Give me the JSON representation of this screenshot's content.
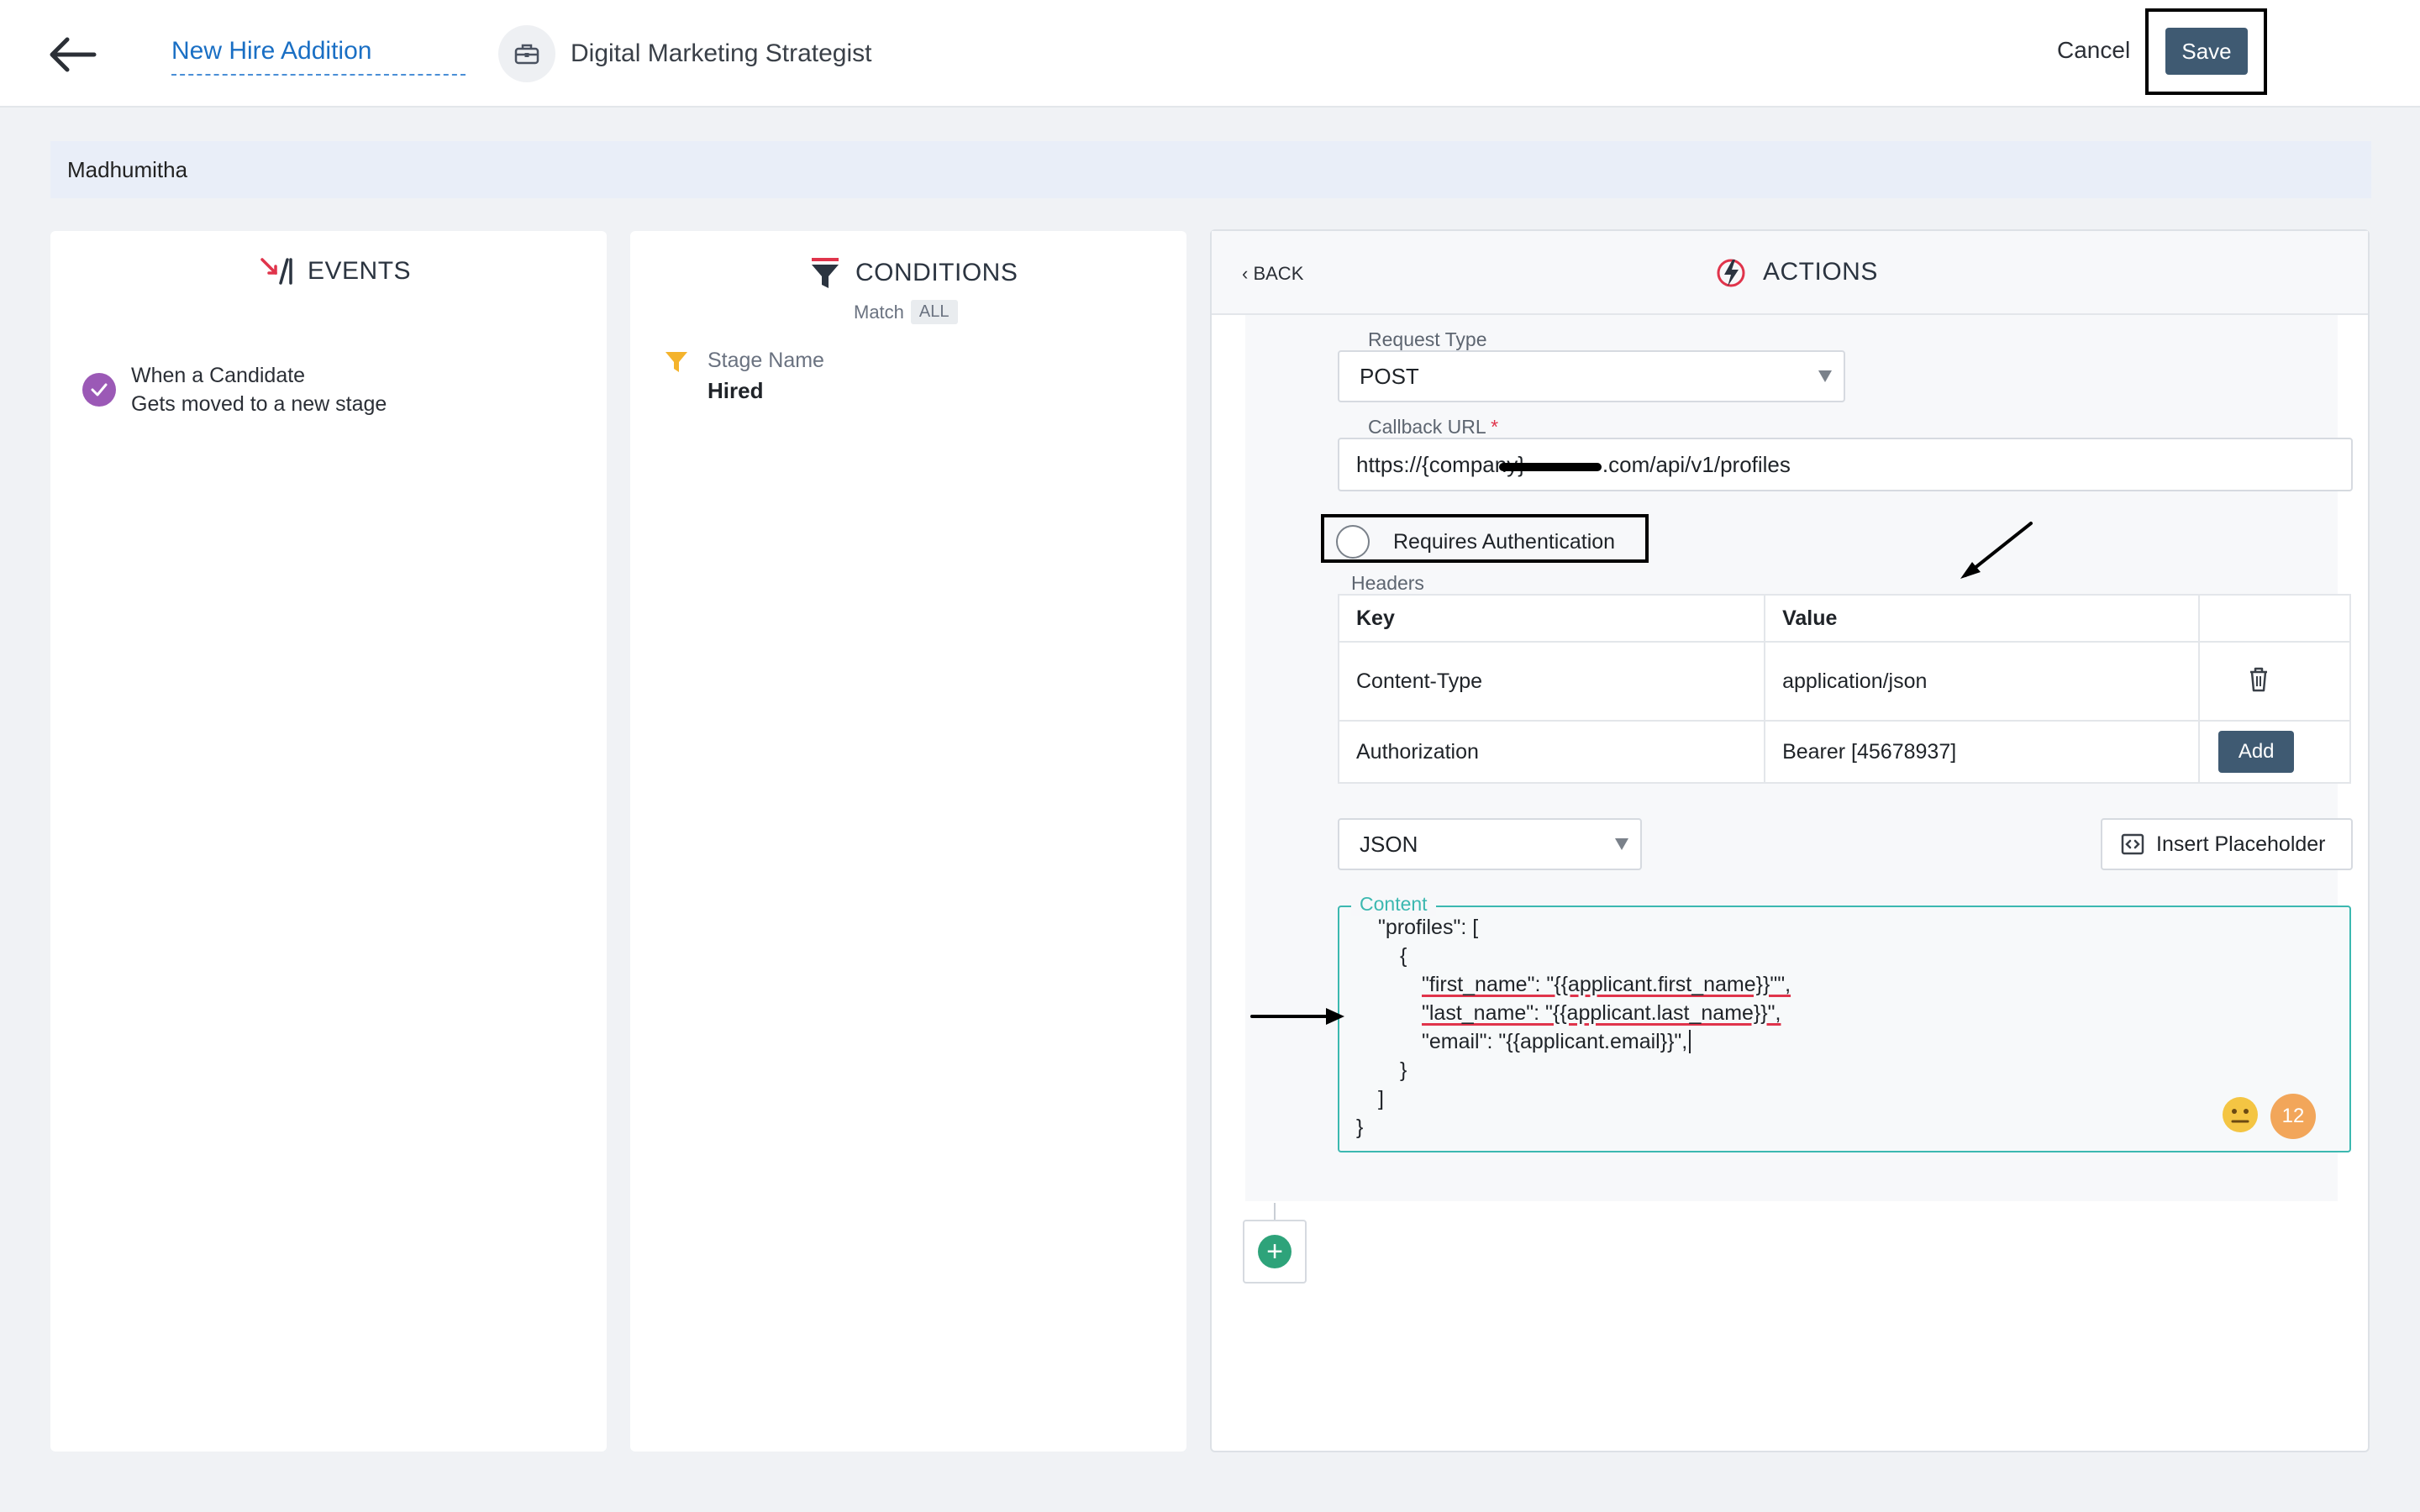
{
  "header": {
    "page_title": "New Hire Addition",
    "job_title": "Digital Marketing Strategist",
    "cancel_label": "Cancel",
    "save_label": "Save"
  },
  "candidate_name": "Madhumitha",
  "events": {
    "heading": "EVENTS",
    "items": [
      {
        "line1": "When a Candidate",
        "line2": "Gets moved to a new stage"
      }
    ]
  },
  "conditions": {
    "heading": "CONDITIONS",
    "match_label": "Match",
    "match_value": "ALL",
    "items": [
      {
        "label": "Stage Name",
        "value": "Hired"
      }
    ]
  },
  "actions": {
    "back_label": "BACK",
    "heading": "ACTIONS",
    "request_type_label": "Request Type",
    "request_type_value": "POST",
    "callback_url_label": "Callback URL",
    "required_marker": "*",
    "callback_url_prefix": "https://{company}",
    "callback_url_suffix": ".com/api/v1/profiles",
    "requires_auth_label": "Requires Authentication",
    "headers_label": "Headers",
    "headers_table": {
      "columns": [
        "Key",
        "Value"
      ],
      "rows": [
        {
          "key": "Content-Type",
          "value": "application/json"
        },
        {
          "key": "Authorization",
          "value": "Bearer [45678937]"
        }
      ],
      "add_label": "Add"
    },
    "format_value": "JSON",
    "insert_placeholder_label": "Insert Placeholder",
    "content_label": "Content",
    "content_lines": [
      "\"profiles\": [",
      "{",
      "\"first_name\": \"{{applicant.first_name}}\"\",",
      "\"last_name\": \"{{applicant.last_name}}\",",
      "\"email\": \"{{applicant.email}}\",",
      "}",
      "]",
      "}"
    ],
    "char_count": "12"
  },
  "colors": {
    "accent_blue": "#1a6fc4",
    "save_button": "#3f5a72",
    "check_purple": "#9b59b6",
    "content_border": "#3cb8b0",
    "badge_orange": "#f2a65a",
    "add_green": "#2ea37a"
  },
  "icons": {
    "back": "arrow-left-icon",
    "job": "briefcase-icon",
    "events": "events-logo-icon",
    "conditions": "filter-icon",
    "actions": "lightning-icon",
    "trash": "trash-icon",
    "insert": "code-bracket-icon",
    "emoji": "neutral-face-icon",
    "add_step": "plus-circle-icon"
  }
}
